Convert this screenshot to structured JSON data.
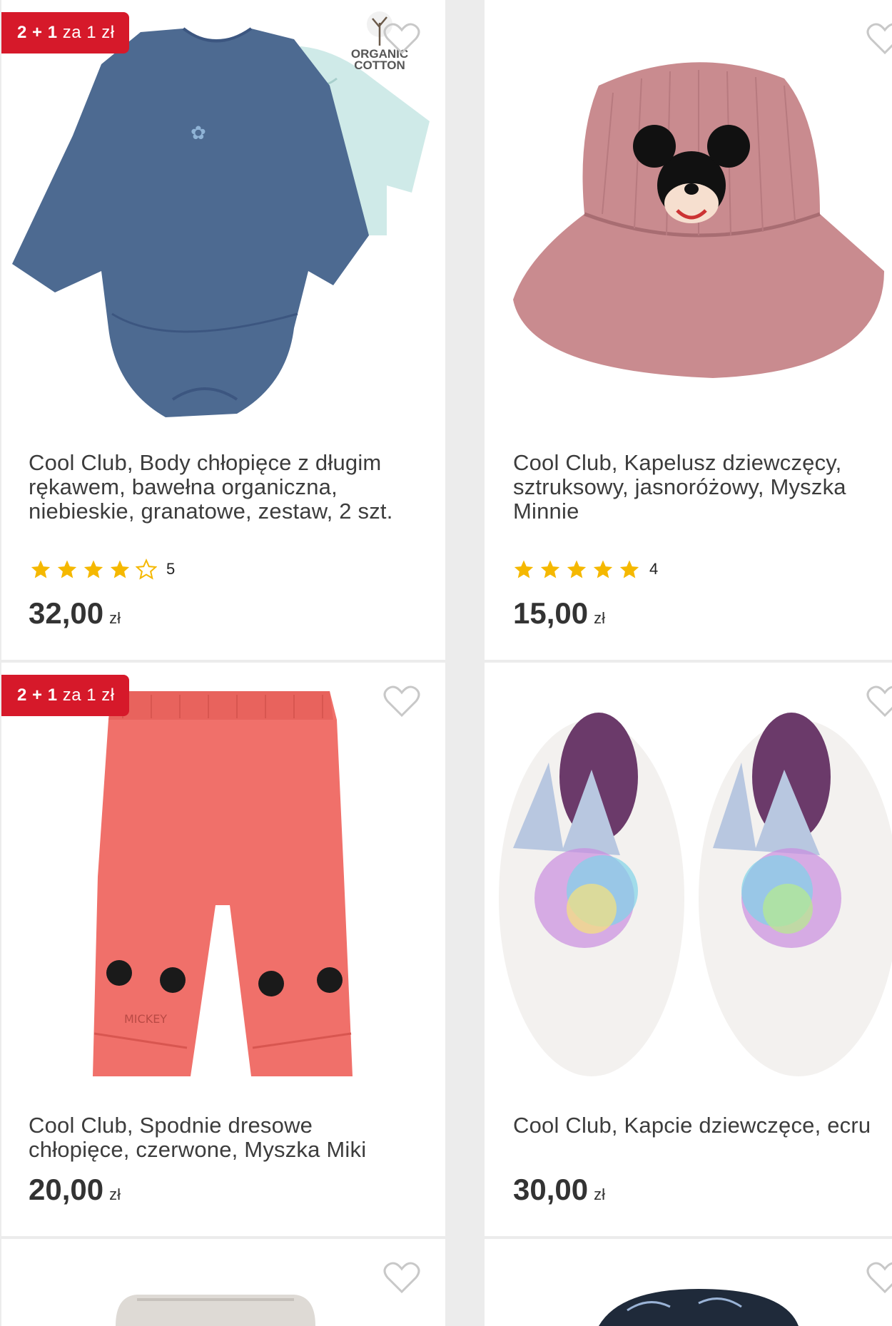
{
  "colors": {
    "badge": "#d6192a",
    "star": "#f5b800",
    "price": "#333333"
  },
  "products": [
    {
      "badge": {
        "main": "2 + 1",
        "small": "za 1 zł"
      },
      "organic": "ORGANIC COTTON",
      "title": "Cool Club, Body chłopięce z długim rękawem, bawełna organiczna, niebieskie, granatowe, zestaw, 2 szt.",
      "rating": 4,
      "rating_count": "5",
      "price": "32,00",
      "currency": "zł"
    },
    {
      "title": "Cool Club, Kapelusz dziewczęcy, sztruksowy, jasnoróżowy, Myszka Minnie",
      "rating": 5,
      "rating_count": "4",
      "price": "15,00",
      "currency": "zł"
    },
    {
      "badge": {
        "main": "2 + 1",
        "small": "za 1 zł"
      },
      "title": "Cool Club, Spodnie dresowe chłopięce, czerwone, Myszka Miki",
      "price": "20,00",
      "currency": "zł"
    },
    {
      "title": "Cool Club, Kapcie dziewczęce, ecru",
      "price": "30,00",
      "currency": "zł"
    }
  ]
}
